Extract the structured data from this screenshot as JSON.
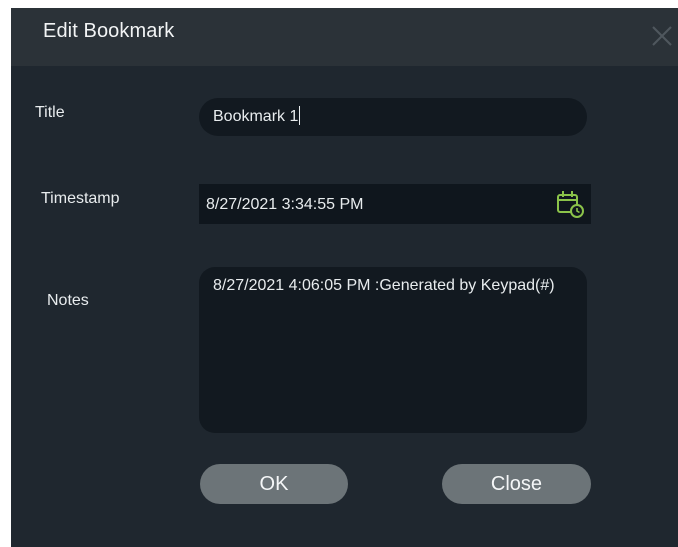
{
  "dialog": {
    "title": "Edit Bookmark",
    "close_icon": "close-x-icon",
    "calendar_icon": "calendar-clock-icon",
    "accent_color": "#8bc34a"
  },
  "fields": {
    "title_label": "Title",
    "title_value": "Bookmark 1",
    "timestamp_label": "Timestamp",
    "timestamp_value": "8/27/2021 3:34:55 PM",
    "notes_label": "Notes",
    "notes_value": "8/27/2021 4:06:05 PM :Generated by Keypad(#)"
  },
  "buttons": {
    "ok_label": "OK",
    "close_label": "Close"
  }
}
